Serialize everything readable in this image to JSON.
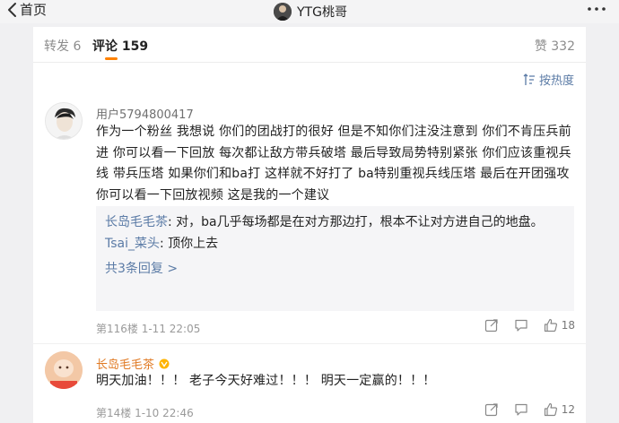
{
  "nav": {
    "back_label": "首页",
    "title": "YTG桃哥"
  },
  "tabs": {
    "repost": "转发 6",
    "comment": "评论 159",
    "like": "赞 332"
  },
  "sort_label": "按热度",
  "comments": [
    {
      "username": "用户5794800417",
      "text": "作为一个粉丝  我想说  你们的团战打的很好  但是不知你们注没注意到  你们不肯压兵前进  你可以看一下回放  每次都让敌方带兵破塔  最后导致局势特别紧张  你们应该重视兵线  带兵压塔  如果你们和ba打 这样就不好打了 ba特别重视兵线压塔 最后在开团强攻  你可以看一下回放视频 这是我的一个建议",
      "replies": [
        {
          "name": "长岛毛毛茶",
          "sep": ": ",
          "text": "对，ba几乎每场都是在对方那边打，根本不让对方进自己的地盘。"
        },
        {
          "name": "Tsai_菜头",
          "sep": ": ",
          "text": "顶你上去"
        }
      ],
      "more_replies": "共3条回复 >",
      "meta": "第116楼  1-11 22:05",
      "likes": "18"
    },
    {
      "username": "长岛毛毛茶",
      "text": "明天加油！！！  老子今天好难过！！！  明天一定赢的！！！",
      "meta": "第14楼  1-10 22:46",
      "likes": "12"
    }
  ],
  "colors": {
    "accent": "#ff8200",
    "link": "#5b7ba6",
    "vip_name": "#e07a24"
  }
}
